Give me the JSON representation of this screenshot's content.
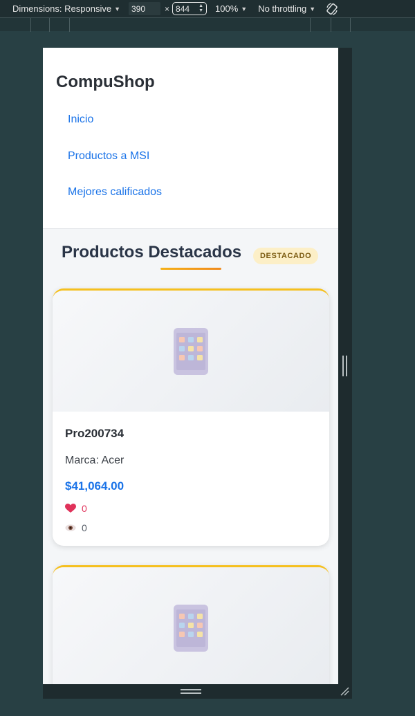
{
  "devtools": {
    "dimensions_label": "Dimensions: Responsive",
    "width_value": "390",
    "times_sign": "×",
    "height_value": "844",
    "zoom_label": "100%",
    "throttling_label": "No throttling"
  },
  "site": {
    "brand": "CompuShop",
    "nav": [
      {
        "label": "Inicio"
      },
      {
        "label": "Productos a MSI"
      },
      {
        "label": "Mejores calificados"
      }
    ]
  },
  "section": {
    "title": "Productos Destacados",
    "badge": "DESTACADO"
  },
  "products": [
    {
      "name": "Pro200734",
      "brand": "Marca: Acer",
      "price": "$41,064.00",
      "likes": "0",
      "views": "0",
      "icon": "tablet-icon"
    },
    {
      "icon": "tablet-icon"
    }
  ],
  "colors": {
    "accent": "#1a73e8",
    "card_border": "#f5c01f",
    "badge_bg": "#fcefc7",
    "like": "#e0325a"
  }
}
